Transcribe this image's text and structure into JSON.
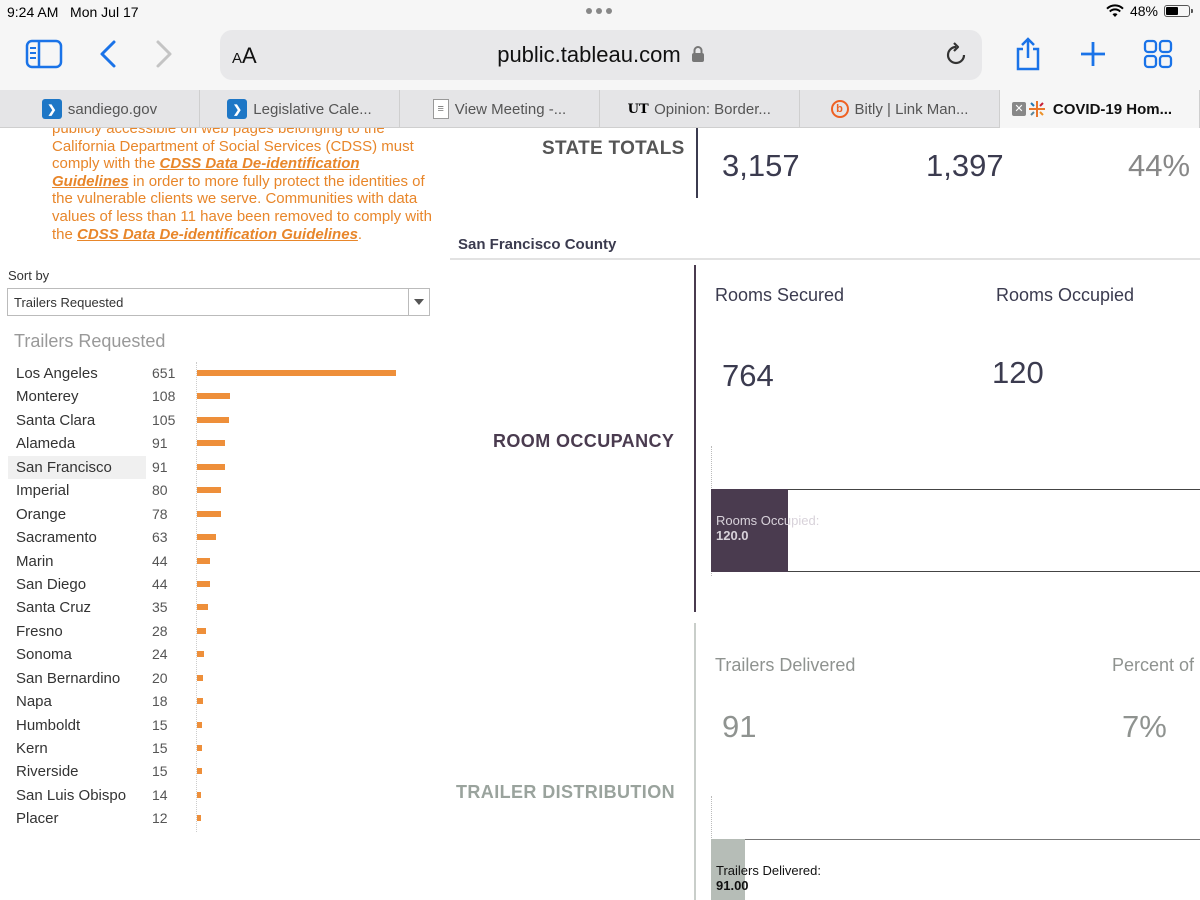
{
  "status_bar": {
    "time": "9:24 AM",
    "date": "Mon Jul 17",
    "battery": "48%",
    "battery_level": 0.48
  },
  "toolbar": {
    "text_size_label": "AA",
    "url": "public.tableau.com",
    "icons": [
      "sidebar-icon",
      "back-icon",
      "forward-icon",
      "lock-icon",
      "reload-icon",
      "share-icon",
      "new-tab-icon",
      "tab-overview-icon"
    ]
  },
  "tabs": [
    {
      "label": "sandiego.gov",
      "icon": "sandiego-favicon"
    },
    {
      "label": "Legislative Cale...",
      "icon": "sandiego-favicon"
    },
    {
      "label": "View Meeting -...",
      "icon": "document-favicon"
    },
    {
      "label": "Opinion: Border...",
      "icon": "ut-favicon",
      "icon_text": "UT"
    },
    {
      "label": "Bitly | Link Man...",
      "icon": "bitly-favicon",
      "icon_text": "b"
    },
    {
      "label": "COVID-19 Hom...",
      "icon": "tableau-favicon",
      "active": true
    }
  ],
  "left_panel": {
    "note": {
      "line1": "publicly accessible on web pages belonging to the California Department of Social Services (CDSS) must comply with the ",
      "link1": "CDSS Data De-identification Guidelines",
      "line2": " in order to more fully protect the identities of the vulnerable clients we serve. Communities with data values of less than 11 have been removed to comply with the ",
      "link2": "CDSS Data De-identification Guidelines",
      "line3": "."
    },
    "sort_label": "Sort by",
    "sort_value": "Trailers Requested",
    "chart_title": "Trailers Requested",
    "highlighted": "San Francisco"
  },
  "chart_data": {
    "type": "bar",
    "orientation": "horizontal",
    "title": "Trailers Requested",
    "categories": [
      "Los Angeles",
      "Monterey",
      "Santa Clara",
      "Alameda",
      "San Francisco",
      "Imperial",
      "Orange",
      "Sacramento",
      "Marin",
      "San Diego",
      "Santa Cruz",
      "Fresno",
      "Sonoma",
      "San Bernardino",
      "Napa",
      "Humboldt",
      "Kern",
      "Riverside",
      "San Luis Obispo",
      "Placer"
    ],
    "values": [
      651,
      108,
      105,
      91,
      91,
      80,
      78,
      63,
      44,
      44,
      35,
      28,
      24,
      20,
      18,
      15,
      15,
      15,
      14,
      12
    ],
    "color": "#ee8f3a",
    "xlim": [
      0,
      651
    ]
  },
  "right_panel": {
    "state_label": "STATE TOTALS",
    "state_values": [
      "3,157",
      "1,397",
      "44%"
    ],
    "county": "San Francisco County",
    "occupancy": {
      "label": "ROOM OCCUPANCY",
      "secured_label": "Rooms Secured",
      "occupied_label": "Rooms Occupied",
      "secured_value": "764",
      "occupied_value": "120",
      "bar_tip_label": "Rooms Occupied:",
      "bar_tip_value": "120.0",
      "occupied_fraction": 0.157,
      "color": "#4a3b4f"
    },
    "trailers": {
      "label": "TRAILER DISTRIBUTION",
      "delivered_label": "Trailers Delivered",
      "percent_label": "Percent of",
      "delivered_value": "91",
      "percent_value": "7%",
      "bar_tip_label": "Trailers Delivered:",
      "bar_tip_value": "91.00",
      "delivered_fraction": 0.07,
      "color": "#b6bdb7"
    }
  }
}
